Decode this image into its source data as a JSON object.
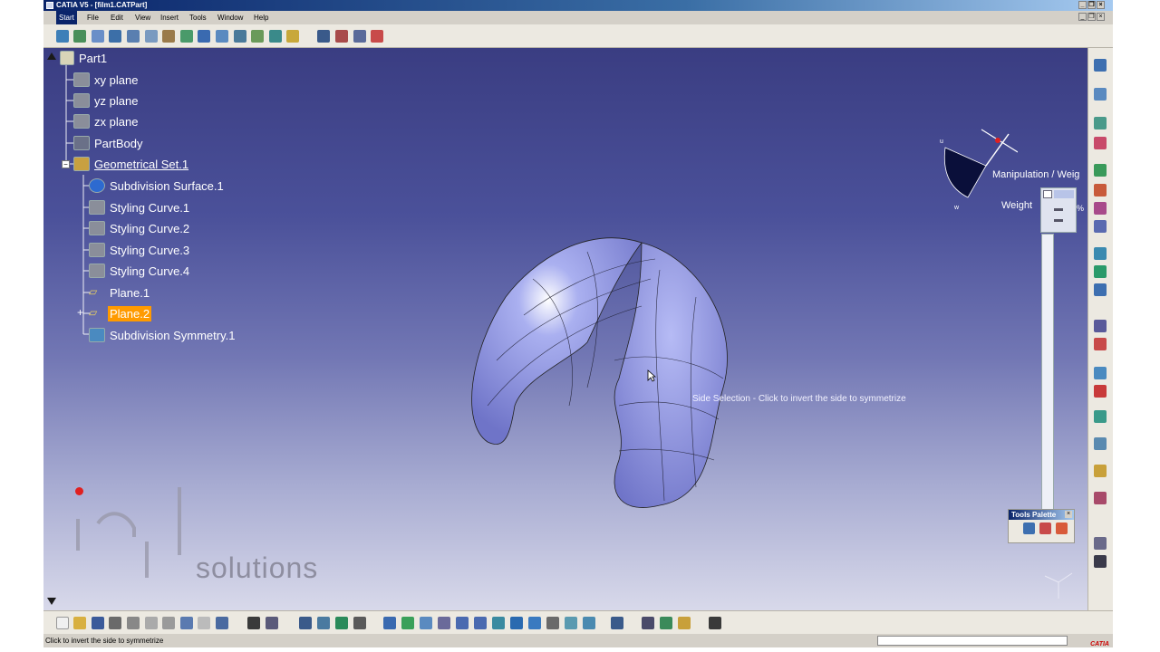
{
  "window": {
    "title": "CATIA V5 - [film1.CATPart]",
    "minimize": "_",
    "restore": "❐",
    "close": "×"
  },
  "menu": {
    "items": [
      "Start",
      "File",
      "Edit",
      "View",
      "Insert",
      "Tools",
      "Window",
      "Help"
    ]
  },
  "tree": {
    "root": "Part1",
    "nodes": [
      {
        "label": "xy plane",
        "icon": "plane-icon"
      },
      {
        "label": "yz plane",
        "icon": "plane-icon"
      },
      {
        "label": "zx plane",
        "icon": "plane-icon"
      },
      {
        "label": "PartBody",
        "icon": "partbody-icon"
      },
      {
        "label": "Geometrical Set.1",
        "icon": "geometrical-set-icon"
      },
      {
        "label": "Subdivision Surface.1",
        "icon": "subdivision-surface-icon"
      },
      {
        "label": "Styling Curve.1",
        "icon": "styling-curve-icon"
      },
      {
        "label": "Styling Curve.2",
        "icon": "styling-curve-icon"
      },
      {
        "label": "Styling Curve.3",
        "icon": "styling-curve-icon"
      },
      {
        "label": "Styling Curve.4",
        "icon": "styling-curve-icon"
      },
      {
        "label": "Plane.1",
        "icon": "plane-icon"
      },
      {
        "label": "Plane.2",
        "icon": "plane-icon",
        "selected": true
      },
      {
        "label": "Subdivision Symmetry.1",
        "icon": "subdivision-symmetry-icon"
      }
    ]
  },
  "viewport": {
    "manipulation_label": "Manipulation / Weig",
    "weight_label": "Weight",
    "percent_label": "%",
    "side_selection_hint": "Side Selection - Click to invert the side to symmetrize",
    "watermark": "solutions"
  },
  "tools_palette": {
    "title": "Tools Palette",
    "close": "×"
  },
  "status": {
    "message": "Click to invert the side to symmetrize"
  },
  "brand": {
    "logo_text": "CATIA",
    "accent": "#ff9a00",
    "background_top": "#3a3d82",
    "background_bottom": "#d8d9ea"
  }
}
